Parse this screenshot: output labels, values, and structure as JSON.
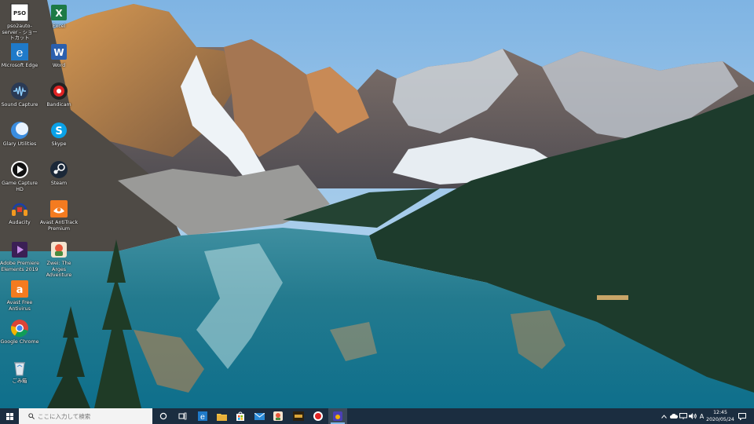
{
  "desktop": {
    "icons": [
      {
        "label": "pso2auto-server - ショートカット",
        "icon": "pso2-icon"
      },
      {
        "label": "Excel",
        "icon": "excel-icon"
      },
      {
        "label": "Microsoft Edge",
        "icon": "edge-icon"
      },
      {
        "label": "Word",
        "icon": "word-icon"
      },
      {
        "label": "Sound Capture",
        "icon": "sound-capture-icon"
      },
      {
        "label": "Bandicam",
        "icon": "bandicam-icon"
      },
      {
        "label": "Glary Utilities",
        "icon": "glary-icon"
      },
      {
        "label": "Skype",
        "icon": "skype-icon"
      },
      {
        "label": "Game Capture HD",
        "icon": "game-capture-icon"
      },
      {
        "label": "Steam",
        "icon": "steam-icon"
      },
      {
        "label": "Audacity",
        "icon": "audacity-icon"
      },
      {
        "label": "Avast AntiTrack Premium",
        "icon": "antitrack-icon"
      },
      {
        "label": "Adobe Premiere Elements 2019",
        "icon": "premiere-icon"
      },
      {
        "label": "Zwei: The Arges Adventure",
        "icon": "zwei-icon"
      },
      {
        "label": "Avast Free Antivirus",
        "icon": "avast-icon"
      },
      {
        "label": "Google Chrome",
        "icon": "chrome-icon"
      },
      {
        "label": "ごみ箱",
        "icon": "recycle-bin-icon"
      }
    ]
  },
  "taskbar": {
    "search_placeholder": "ここに入力して検索",
    "apps": [
      "cortana-icon",
      "task-view-icon",
      "edge-icon",
      "file-explorer-icon",
      "store-icon",
      "mail-icon",
      "game-app-icon",
      "game-app-2-icon",
      "bandicam-icon",
      "avast-icon"
    ],
    "tray": {
      "ime": "A",
      "time": "12:45",
      "date": "2020/05/24"
    }
  },
  "colors": {
    "taskbar_bg": "#1b2d40",
    "accent": "#7fb8e6"
  }
}
